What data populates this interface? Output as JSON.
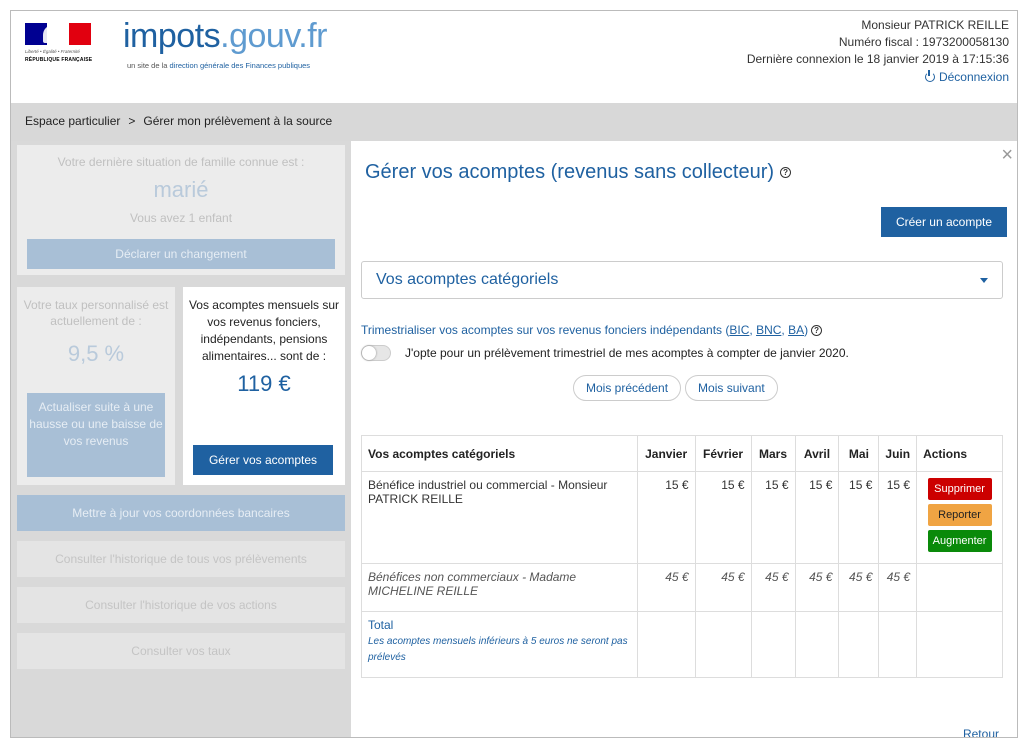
{
  "header": {
    "logo_main": "impots",
    "logo_domain": ".gouv.fr",
    "logo_sub_prefix": "un site de la ",
    "logo_sub_highlight": "direction générale des Finances publiques",
    "motto": "Liberté • Égalité • Fraternité",
    "republic": "RÉPUBLIQUE FRANÇAISE",
    "user_name": "Monsieur PATRICK REILLE",
    "fiscal_number": "Numéro fiscal : 1973200058130",
    "last_login": "Dernière connexion le 18 janvier 2019 à 17:15:36",
    "logout": "Déconnexion"
  },
  "breadcrumb": {
    "root": "Espace particulier",
    "separator": ">",
    "current": "Gérer mon prélèvement à la source"
  },
  "left": {
    "family_intro": "Votre dernière situation de famille connue est :",
    "family_status": "marié",
    "children": "Vous avez 1 enfant",
    "declare_change": "Déclarer un changement",
    "rate_intro": "Votre taux personnalisé est actuellement de :",
    "rate_value": "9,5 %",
    "rate_update": "Actualiser suite à une hausse ou une baisse de vos revenus",
    "acomptes_intro": "Vos acomptes mensuels sur vos revenus fonciers, indépendants, pensions alimentaires... sont de :",
    "acomptes_value": "119 €",
    "manage_acomptes": "Gérer vos acomptes",
    "update_bank": "Mettre à jour vos coordonnées bancaires",
    "history_all": "Consulter l'historique de tous vos prélèvements",
    "history_actions": "Consulter l'historique de vos actions",
    "view_rates": "Consulter vos taux"
  },
  "modal": {
    "title": "Gérer vos acomptes (revenus sans collecteur)",
    "help": "?",
    "close": "×",
    "create_button": "Créer un acompte",
    "select_label": "Vos acomptes catégoriels",
    "trim_text": "Trimestrialiser vos acomptes sur vos revenus fonciers indépendants (",
    "trim_bic": "BIC",
    "trim_bnc": "BNC",
    "trim_ba": "BA",
    "trim_close": ")",
    "opt_in_text": "J'opte pour un prélèvement trimestriel de mes acomptes à compter de janvier 2020.",
    "prev_month": "Mois précédent",
    "next_month": "Mois suivant",
    "retour": "Retour"
  },
  "table": {
    "headers": [
      "Vos acomptes catégoriels",
      "Janvier",
      "Février",
      "Mars",
      "Avril",
      "Mai",
      "Juin",
      "Actions"
    ],
    "rows": [
      {
        "label": "Bénéfice industriel ou commercial - Monsieur PATRICK REILLE",
        "values": [
          "15 €",
          "15 €",
          "15 €",
          "15 €",
          "15 €",
          "15 €"
        ],
        "actions": [
          "Supprimer",
          "Reporter",
          "Augmenter"
        ]
      },
      {
        "label": "Bénéfices non commerciaux - Madame MICHELINE REILLE",
        "values": [
          "45 €",
          "45 €",
          "45 €",
          "45 €",
          "45 €",
          "45 €"
        ]
      }
    ],
    "total_label": "Total",
    "total_note": "Les acomptes mensuels inférieurs à 5 euros ne seront pas prélevés"
  },
  "colors": {
    "brand_blue": "#1f61a1",
    "delete": "#cc0000",
    "postpone": "#f0a443",
    "increase": "#0a8a0a"
  }
}
